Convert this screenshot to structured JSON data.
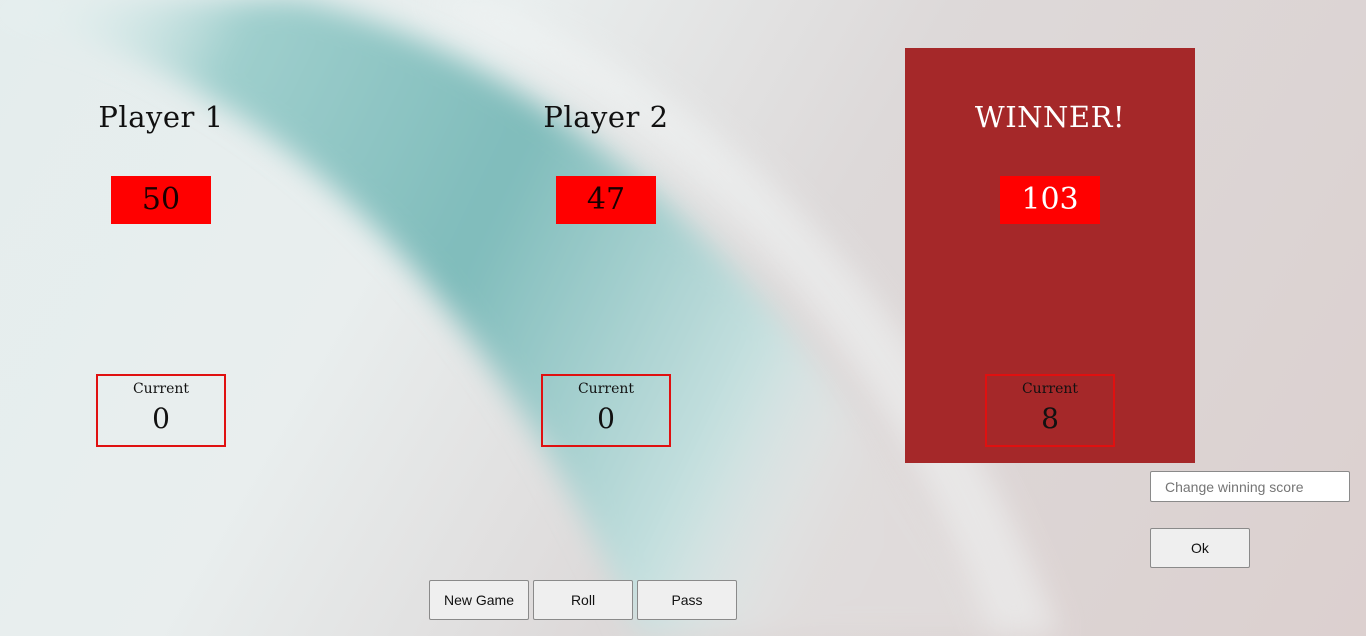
{
  "players": [
    {
      "name": "Player 1",
      "score": "50",
      "current_label": "Current",
      "current": "0"
    },
    {
      "name": "Player 2",
      "score": "47",
      "current_label": "Current",
      "current": "0"
    },
    {
      "name": "WINNER!",
      "score": "103",
      "current_label": "Current",
      "current": "8"
    }
  ],
  "controls": {
    "new_game": "New Game",
    "roll": "Roll",
    "pass": "Pass",
    "winning_score_placeholder": "Change winning score",
    "winning_score_value": "",
    "ok": "Ok"
  },
  "colors": {
    "winner_panel": "#a52829",
    "score_box": "#ff0000",
    "current_border": "#e01010",
    "background_teal": "#86c2c1"
  }
}
